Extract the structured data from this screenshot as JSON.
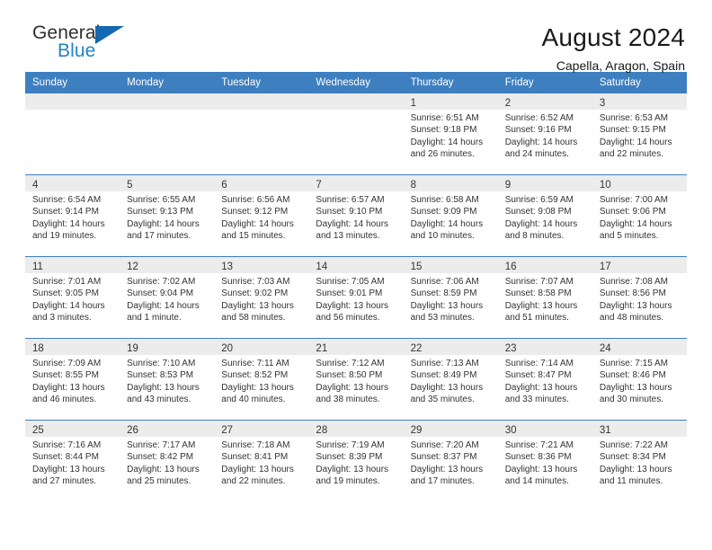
{
  "brand": {
    "name_top": "General",
    "name_bottom": "Blue",
    "triangle_color": "#1668b0",
    "blue_color": "#2283c8"
  },
  "header": {
    "title": "August 2024",
    "subtitle": "Capella, Aragon, Spain"
  },
  "theme": {
    "header_blue": "#3d7fbf",
    "daynum_strip": "#ececec",
    "text": "#333333"
  },
  "weekdays": [
    "Sunday",
    "Monday",
    "Tuesday",
    "Wednesday",
    "Thursday",
    "Friday",
    "Saturday"
  ],
  "weeks": [
    [
      {
        "day": "",
        "empty": true
      },
      {
        "day": "",
        "empty": true
      },
      {
        "day": "",
        "empty": true
      },
      {
        "day": "",
        "empty": true
      },
      {
        "day": "1",
        "sunrise": "Sunrise: 6:51 AM",
        "sunset": "Sunset: 9:18 PM",
        "daylight1": "Daylight: 14 hours",
        "daylight2": "and 26 minutes."
      },
      {
        "day": "2",
        "sunrise": "Sunrise: 6:52 AM",
        "sunset": "Sunset: 9:16 PM",
        "daylight1": "Daylight: 14 hours",
        "daylight2": "and 24 minutes."
      },
      {
        "day": "3",
        "sunrise": "Sunrise: 6:53 AM",
        "sunset": "Sunset: 9:15 PM",
        "daylight1": "Daylight: 14 hours",
        "daylight2": "and 22 minutes."
      }
    ],
    [
      {
        "day": "4",
        "sunrise": "Sunrise: 6:54 AM",
        "sunset": "Sunset: 9:14 PM",
        "daylight1": "Daylight: 14 hours",
        "daylight2": "and 19 minutes."
      },
      {
        "day": "5",
        "sunrise": "Sunrise: 6:55 AM",
        "sunset": "Sunset: 9:13 PM",
        "daylight1": "Daylight: 14 hours",
        "daylight2": "and 17 minutes."
      },
      {
        "day": "6",
        "sunrise": "Sunrise: 6:56 AM",
        "sunset": "Sunset: 9:12 PM",
        "daylight1": "Daylight: 14 hours",
        "daylight2": "and 15 minutes."
      },
      {
        "day": "7",
        "sunrise": "Sunrise: 6:57 AM",
        "sunset": "Sunset: 9:10 PM",
        "daylight1": "Daylight: 14 hours",
        "daylight2": "and 13 minutes."
      },
      {
        "day": "8",
        "sunrise": "Sunrise: 6:58 AM",
        "sunset": "Sunset: 9:09 PM",
        "daylight1": "Daylight: 14 hours",
        "daylight2": "and 10 minutes."
      },
      {
        "day": "9",
        "sunrise": "Sunrise: 6:59 AM",
        "sunset": "Sunset: 9:08 PM",
        "daylight1": "Daylight: 14 hours",
        "daylight2": "and 8 minutes."
      },
      {
        "day": "10",
        "sunrise": "Sunrise: 7:00 AM",
        "sunset": "Sunset: 9:06 PM",
        "daylight1": "Daylight: 14 hours",
        "daylight2": "and 5 minutes."
      }
    ],
    [
      {
        "day": "11",
        "sunrise": "Sunrise: 7:01 AM",
        "sunset": "Sunset: 9:05 PM",
        "daylight1": "Daylight: 14 hours",
        "daylight2": "and 3 minutes."
      },
      {
        "day": "12",
        "sunrise": "Sunrise: 7:02 AM",
        "sunset": "Sunset: 9:04 PM",
        "daylight1": "Daylight: 14 hours",
        "daylight2": "and 1 minute."
      },
      {
        "day": "13",
        "sunrise": "Sunrise: 7:03 AM",
        "sunset": "Sunset: 9:02 PM",
        "daylight1": "Daylight: 13 hours",
        "daylight2": "and 58 minutes."
      },
      {
        "day": "14",
        "sunrise": "Sunrise: 7:05 AM",
        "sunset": "Sunset: 9:01 PM",
        "daylight1": "Daylight: 13 hours",
        "daylight2": "and 56 minutes."
      },
      {
        "day": "15",
        "sunrise": "Sunrise: 7:06 AM",
        "sunset": "Sunset: 8:59 PM",
        "daylight1": "Daylight: 13 hours",
        "daylight2": "and 53 minutes."
      },
      {
        "day": "16",
        "sunrise": "Sunrise: 7:07 AM",
        "sunset": "Sunset: 8:58 PM",
        "daylight1": "Daylight: 13 hours",
        "daylight2": "and 51 minutes."
      },
      {
        "day": "17",
        "sunrise": "Sunrise: 7:08 AM",
        "sunset": "Sunset: 8:56 PM",
        "daylight1": "Daylight: 13 hours",
        "daylight2": "and 48 minutes."
      }
    ],
    [
      {
        "day": "18",
        "sunrise": "Sunrise: 7:09 AM",
        "sunset": "Sunset: 8:55 PM",
        "daylight1": "Daylight: 13 hours",
        "daylight2": "and 46 minutes."
      },
      {
        "day": "19",
        "sunrise": "Sunrise: 7:10 AM",
        "sunset": "Sunset: 8:53 PM",
        "daylight1": "Daylight: 13 hours",
        "daylight2": "and 43 minutes."
      },
      {
        "day": "20",
        "sunrise": "Sunrise: 7:11 AM",
        "sunset": "Sunset: 8:52 PM",
        "daylight1": "Daylight: 13 hours",
        "daylight2": "and 40 minutes."
      },
      {
        "day": "21",
        "sunrise": "Sunrise: 7:12 AM",
        "sunset": "Sunset: 8:50 PM",
        "daylight1": "Daylight: 13 hours",
        "daylight2": "and 38 minutes."
      },
      {
        "day": "22",
        "sunrise": "Sunrise: 7:13 AM",
        "sunset": "Sunset: 8:49 PM",
        "daylight1": "Daylight: 13 hours",
        "daylight2": "and 35 minutes."
      },
      {
        "day": "23",
        "sunrise": "Sunrise: 7:14 AM",
        "sunset": "Sunset: 8:47 PM",
        "daylight1": "Daylight: 13 hours",
        "daylight2": "and 33 minutes."
      },
      {
        "day": "24",
        "sunrise": "Sunrise: 7:15 AM",
        "sunset": "Sunset: 8:46 PM",
        "daylight1": "Daylight: 13 hours",
        "daylight2": "and 30 minutes."
      }
    ],
    [
      {
        "day": "25",
        "sunrise": "Sunrise: 7:16 AM",
        "sunset": "Sunset: 8:44 PM",
        "daylight1": "Daylight: 13 hours",
        "daylight2": "and 27 minutes."
      },
      {
        "day": "26",
        "sunrise": "Sunrise: 7:17 AM",
        "sunset": "Sunset: 8:42 PM",
        "daylight1": "Daylight: 13 hours",
        "daylight2": "and 25 minutes."
      },
      {
        "day": "27",
        "sunrise": "Sunrise: 7:18 AM",
        "sunset": "Sunset: 8:41 PM",
        "daylight1": "Daylight: 13 hours",
        "daylight2": "and 22 minutes."
      },
      {
        "day": "28",
        "sunrise": "Sunrise: 7:19 AM",
        "sunset": "Sunset: 8:39 PM",
        "daylight1": "Daylight: 13 hours",
        "daylight2": "and 19 minutes."
      },
      {
        "day": "29",
        "sunrise": "Sunrise: 7:20 AM",
        "sunset": "Sunset: 8:37 PM",
        "daylight1": "Daylight: 13 hours",
        "daylight2": "and 17 minutes."
      },
      {
        "day": "30",
        "sunrise": "Sunrise: 7:21 AM",
        "sunset": "Sunset: 8:36 PM",
        "daylight1": "Daylight: 13 hours",
        "daylight2": "and 14 minutes."
      },
      {
        "day": "31",
        "sunrise": "Sunrise: 7:22 AM",
        "sunset": "Sunset: 8:34 PM",
        "daylight1": "Daylight: 13 hours",
        "daylight2": "and 11 minutes."
      }
    ]
  ]
}
